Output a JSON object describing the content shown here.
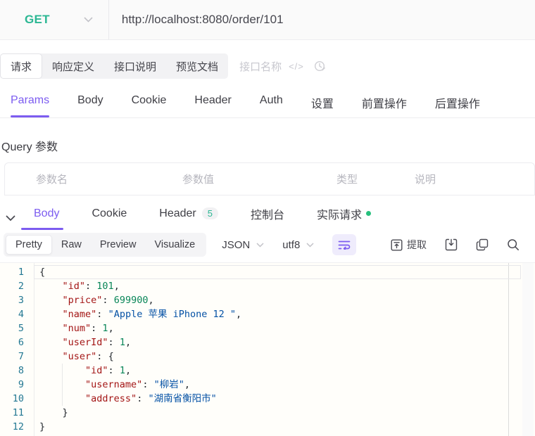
{
  "request_bar": {
    "method": "GET",
    "url": "http://localhost:8080/order/101"
  },
  "doc_tabs": {
    "items": [
      {
        "key": "request",
        "label": "请求",
        "active": true
      },
      {
        "key": "response-definition",
        "label": "响应定义",
        "active": false
      },
      {
        "key": "api-description",
        "label": "接口说明",
        "active": false
      },
      {
        "key": "preview-docs",
        "label": "预览文档",
        "active": false
      }
    ],
    "name_placeholder": "接口名称",
    "code_icon_label": "</>"
  },
  "request_tabs": {
    "items": [
      {
        "key": "params",
        "label": "Params",
        "active": true
      },
      {
        "key": "body",
        "label": "Body",
        "active": false
      },
      {
        "key": "cookie",
        "label": "Cookie",
        "active": false
      },
      {
        "key": "header",
        "label": "Header",
        "active": false
      },
      {
        "key": "auth",
        "label": "Auth",
        "active": false
      },
      {
        "key": "settings",
        "label": "设置",
        "active": false
      },
      {
        "key": "pre-operations",
        "label": "前置操作",
        "active": false
      },
      {
        "key": "post-operations",
        "label": "后置操作",
        "active": false
      }
    ]
  },
  "query_section": {
    "title": "Query 参数",
    "columns": [
      {
        "key": "name",
        "label": "参数名"
      },
      {
        "key": "value",
        "label": "参数值"
      },
      {
        "key": "type",
        "label": "类型"
      },
      {
        "key": "description",
        "label": "说明"
      }
    ]
  },
  "response_tabs": {
    "items": [
      {
        "key": "body",
        "label": "Body",
        "active": true
      },
      {
        "key": "cookie",
        "label": "Cookie",
        "active": false
      },
      {
        "key": "header",
        "label": "Header",
        "active": false,
        "badge": "5"
      },
      {
        "key": "console",
        "label": "控制台",
        "active": false
      },
      {
        "key": "actual-request",
        "label": "实际请求",
        "active": false,
        "dot": true
      }
    ]
  },
  "viewer_toolbar": {
    "modes": [
      {
        "key": "pretty",
        "label": "Pretty",
        "active": true
      },
      {
        "key": "raw",
        "label": "Raw",
        "active": false
      },
      {
        "key": "preview",
        "label": "Preview",
        "active": false
      },
      {
        "key": "visualize",
        "label": "Visualize",
        "active": false
      }
    ],
    "format": "JSON",
    "encoding": "utf8",
    "extract_label": "提取"
  },
  "icons": [
    "chevron-down-icon",
    "word-wrap-icon",
    "extract-icon",
    "download-icon",
    "copy-icon",
    "search-icon",
    "clock-icon",
    "code-icon"
  ],
  "code": {
    "language": "json",
    "lines": [
      {
        "num": 1,
        "indent": 0,
        "tokens": [
          {
            "t": "brace",
            "v": "{"
          }
        ]
      },
      {
        "num": 2,
        "indent": 1,
        "tokens": [
          {
            "t": "key",
            "v": "\"id\""
          },
          {
            "t": "pln",
            "v": ": "
          },
          {
            "t": "num",
            "v": "101"
          },
          {
            "t": "pln",
            "v": ","
          }
        ]
      },
      {
        "num": 3,
        "indent": 1,
        "tokens": [
          {
            "t": "key",
            "v": "\"price\""
          },
          {
            "t": "pln",
            "v": ": "
          },
          {
            "t": "num",
            "v": "699900"
          },
          {
            "t": "pln",
            "v": ","
          }
        ]
      },
      {
        "num": 4,
        "indent": 1,
        "tokens": [
          {
            "t": "key",
            "v": "\"name\""
          },
          {
            "t": "pln",
            "v": ": "
          },
          {
            "t": "str",
            "v": "\"Apple 苹果 iPhone 12 \""
          },
          {
            "t": "pln",
            "v": ","
          }
        ]
      },
      {
        "num": 5,
        "indent": 1,
        "tokens": [
          {
            "t": "key",
            "v": "\"num\""
          },
          {
            "t": "pln",
            "v": ": "
          },
          {
            "t": "num",
            "v": "1"
          },
          {
            "t": "pln",
            "v": ","
          }
        ]
      },
      {
        "num": 6,
        "indent": 1,
        "tokens": [
          {
            "t": "key",
            "v": "\"userId\""
          },
          {
            "t": "pln",
            "v": ": "
          },
          {
            "t": "num",
            "v": "1"
          },
          {
            "t": "pln",
            "v": ","
          }
        ]
      },
      {
        "num": 7,
        "indent": 1,
        "tokens": [
          {
            "t": "key",
            "v": "\"user\""
          },
          {
            "t": "pln",
            "v": ": "
          },
          {
            "t": "brace",
            "v": "{"
          }
        ]
      },
      {
        "num": 8,
        "indent": 2,
        "tokens": [
          {
            "t": "key",
            "v": "\"id\""
          },
          {
            "t": "pln",
            "v": ": "
          },
          {
            "t": "num",
            "v": "1"
          },
          {
            "t": "pln",
            "v": ","
          }
        ]
      },
      {
        "num": 9,
        "indent": 2,
        "tokens": [
          {
            "t": "key",
            "v": "\"username\""
          },
          {
            "t": "pln",
            "v": ": "
          },
          {
            "t": "str",
            "v": "\"柳岩\""
          },
          {
            "t": "pln",
            "v": ","
          }
        ]
      },
      {
        "num": 10,
        "indent": 2,
        "tokens": [
          {
            "t": "key",
            "v": "\"address\""
          },
          {
            "t": "pln",
            "v": ": "
          },
          {
            "t": "str",
            "v": "\"湖南省衡阳市\""
          }
        ]
      },
      {
        "num": 11,
        "indent": 1,
        "tokens": [
          {
            "t": "brace",
            "v": "}"
          }
        ]
      },
      {
        "num": 12,
        "indent": 0,
        "tokens": [
          {
            "t": "brace",
            "v": "}"
          }
        ]
      }
    ]
  },
  "colors": {
    "accent": "#7c5cf0",
    "method_green": "#2bb793",
    "success_green": "#27c07d",
    "text": "#3f3f46",
    "muted": "#b6b6be",
    "disabled": "#c7c7ce",
    "border": "#ececf0",
    "code_key": "#a31515",
    "code_string": "#0451a5",
    "code_number": "#098658",
    "code_brace": "#24292e",
    "line_number": "#237893",
    "editor_bg": "#fffefa"
  }
}
